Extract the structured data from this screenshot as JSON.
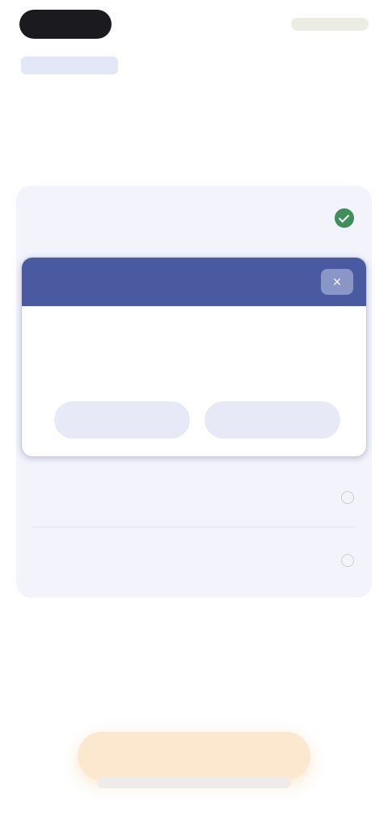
{
  "header": {
    "brand": "",
    "title": ""
  },
  "rows": [
    {
      "label": ""
    },
    {
      "label": ""
    },
    {
      "label": ""
    }
  ],
  "card": {
    "header_title": "",
    "subtitle": "",
    "description": "",
    "button_a": "",
    "button_b": "",
    "close_icon": "close-icon"
  },
  "cta": {
    "label": ""
  },
  "footnote": "",
  "colors": {
    "accent": "#4a5aa0",
    "success": "#3f8f5a",
    "cta": "#fbe8cf"
  }
}
